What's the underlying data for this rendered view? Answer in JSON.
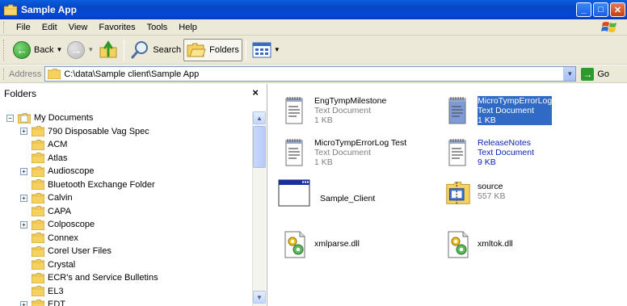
{
  "window": {
    "title": "Sample App"
  },
  "menu": [
    "File",
    "Edit",
    "View",
    "Favorites",
    "Tools",
    "Help"
  ],
  "toolbar": {
    "back": "Back",
    "search": "Search",
    "folders": "Folders"
  },
  "address": {
    "label": "Address",
    "path": "C:\\data\\Sample client\\Sample App",
    "go": "Go"
  },
  "folders_pane": {
    "title": "Folders",
    "close": "×",
    "tree": [
      {
        "label": "My Documents",
        "expander": "⊟",
        "level": 0,
        "icon": "my-documents"
      },
      {
        "label": "790 Disposable Vag Spec",
        "expander": "+",
        "level": 1
      },
      {
        "label": "ACM",
        "expander": "",
        "level": 1
      },
      {
        "label": "Atlas",
        "expander": "",
        "level": 1
      },
      {
        "label": "Audioscope",
        "expander": "+",
        "level": 1
      },
      {
        "label": "Bluetooth Exchange Folder",
        "expander": "",
        "level": 1
      },
      {
        "label": "Calvin",
        "expander": "+",
        "level": 1
      },
      {
        "label": "CAPA",
        "expander": "",
        "level": 1
      },
      {
        "label": "Colposcope",
        "expander": "+",
        "level": 1
      },
      {
        "label": "Connex",
        "expander": "",
        "level": 1
      },
      {
        "label": "Corel User Files",
        "expander": "",
        "level": 1
      },
      {
        "label": "Crystal",
        "expander": "",
        "level": 1
      },
      {
        "label": "ECR's and Service Bulletins",
        "expander": "",
        "level": 1
      },
      {
        "label": "EL3",
        "expander": "",
        "level": 1
      },
      {
        "label": "EDT",
        "expander": "+",
        "level": 1
      }
    ]
  },
  "files": [
    {
      "name": "EngTympMilestone",
      "type": "Text Document",
      "size": "1 KB",
      "icon": "text-document"
    },
    {
      "name": "MicroTympErrorLog",
      "type": "Text Document",
      "size": "1 KB",
      "icon": "text-document",
      "state": "selected"
    },
    {
      "name": "MicroTympErrorLog Test",
      "type": "Text Document",
      "size": "1 KB",
      "icon": "text-document"
    },
    {
      "name": "ReleaseNotes",
      "type": "Text Document",
      "size": "9 KB",
      "icon": "text-document",
      "state": "highlight"
    },
    {
      "name": "Sample_Client",
      "icon": "application-window"
    },
    {
      "name": "source",
      "size": "557 KB",
      "icon": "compressed-folder"
    },
    {
      "name": "xmlparse.dll",
      "icon": "dll-gear"
    },
    {
      "name": "xmltok.dll",
      "icon": "dll-gear"
    }
  ],
  "colors": {
    "titlebar": "#0846c4",
    "selection": "#316ac5",
    "chrome": "#ece9d8",
    "link_blue": "#0a24b5"
  }
}
